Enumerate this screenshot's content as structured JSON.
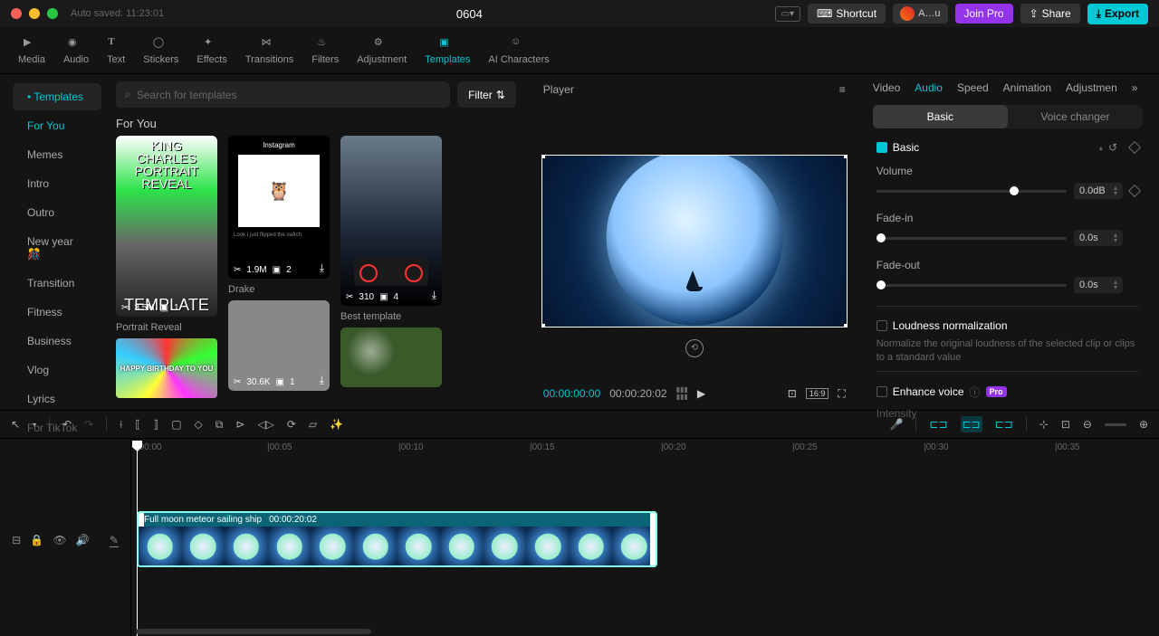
{
  "titlebar": {
    "autosave": "Auto saved: 11:23:01",
    "title": "0604",
    "shortcut": "Shortcut",
    "user": "A…u",
    "join_pro": "Join Pro",
    "share": "Share",
    "export": "Export"
  },
  "topnav": {
    "media": "Media",
    "audio": "Audio",
    "text": "Text",
    "stickers": "Stickers",
    "effects": "Effects",
    "transitions": "Transitions",
    "filters": "Filters",
    "adjustment": "Adjustment",
    "templates": "Templates",
    "ai": "AI Characters"
  },
  "categories": {
    "badge": "Templates",
    "items": [
      "For You",
      "Memes",
      "Intro",
      "Outro",
      "New year 🎊",
      "Transition",
      "Fitness",
      "Business",
      "Vlog",
      "Lyrics",
      "For TikTok"
    ]
  },
  "search": {
    "placeholder": "Search for templates",
    "filter": "Filter"
  },
  "gallery": {
    "header": "For You",
    "c1_top_line1": "KING CHARLES",
    "c1_top_line2": "PORTRAIT REVEAL",
    "c1_bot": "TEMPLATE",
    "c1_stat1": "3.5M",
    "c1_stat2": "1",
    "c1_label": "Portrait Reveal",
    "c2_ig": "Instagram",
    "c2_txt": "Look I just flipped the switch.",
    "c2_stat1": "1.9M",
    "c2_stat2": "2",
    "c2_label": "Drake",
    "c3_stat1": "310",
    "c3_stat2": "4",
    "c3_label": "Best template",
    "c4_stat1": "30.6K",
    "c4_stat2": "1",
    "c4b_text": "HAPPY BIRTHDAY TO YOU"
  },
  "player": {
    "title": "Player",
    "current": "00:00:00:00",
    "duration": "00:00:20:02",
    "ratio": "16:9"
  },
  "props": {
    "tabs": {
      "video": "Video",
      "audio": "Audio",
      "speed": "Speed",
      "animation": "Animation",
      "adjust": "Adjustmen"
    },
    "seg_basic": "Basic",
    "seg_voice": "Voice changer",
    "section_basic": "Basic",
    "volume_label": "Volume",
    "volume_value": "0.0dB",
    "fadein_label": "Fade-in",
    "fadein_value": "0.0s",
    "fadeout_label": "Fade-out",
    "fadeout_value": "0.0s",
    "loudness_title": "Loudness normalization",
    "loudness_desc": "Normalize the original loudness of the selected clip or clips to a standard value",
    "enhance_title": "Enhance voice",
    "pro": "Pro",
    "intensity_label": "Intensity"
  },
  "ruler": [
    "|00:00",
    "|00:05",
    "|00:10",
    "|00:15",
    "|00:20",
    "|00:25",
    "|00:30",
    "|00:35"
  ],
  "clip": {
    "name": "Full moon meteor sailing ship",
    "dur": "00:00:20:02"
  }
}
